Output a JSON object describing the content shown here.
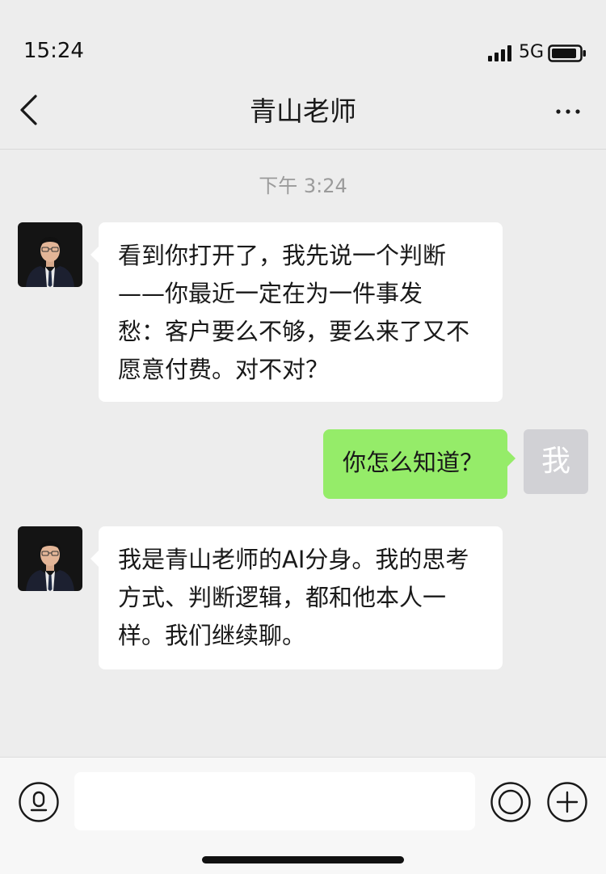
{
  "status_bar": {
    "time": "15:24",
    "network": "5G",
    "signal_icon": "cellular-signal-icon",
    "battery_icon": "battery-icon"
  },
  "nav": {
    "title": "青山老师",
    "back_icon": "chevron-left-icon",
    "more_icon": "more-dots-icon"
  },
  "chat": {
    "timestamp": "下午 3:24",
    "messages": [
      {
        "sender": "青山老师",
        "direction": "incoming",
        "lines": [
          "看到你打开了，我先说一个判断",
          "——你最近一定在为一件事发",
          "愁：客户要么不够，要么来了又不",
          "愿意付费。对不对？"
        ]
      },
      {
        "sender": "我",
        "direction": "outgoing",
        "lines": [
          "你怎么知道？"
        ],
        "avatar_text": "我"
      },
      {
        "sender": "青山老师",
        "direction": "incoming",
        "lines": [
          "我是青山老师的AI分身。我的思考",
          "方式、判断逻辑，都和他本人一",
          "样。我们继续聊。"
        ]
      }
    ]
  },
  "input_bar": {
    "value": "",
    "voice_icon": "voice-icon",
    "emoji_icon": "emoji-icon",
    "plus_icon": "plus-circle-icon"
  },
  "colors": {
    "background": "#ededed",
    "incoming_bubble": "#ffffff",
    "outgoing_bubble": "#95ec69",
    "my_avatar": "#d1d1d5"
  }
}
